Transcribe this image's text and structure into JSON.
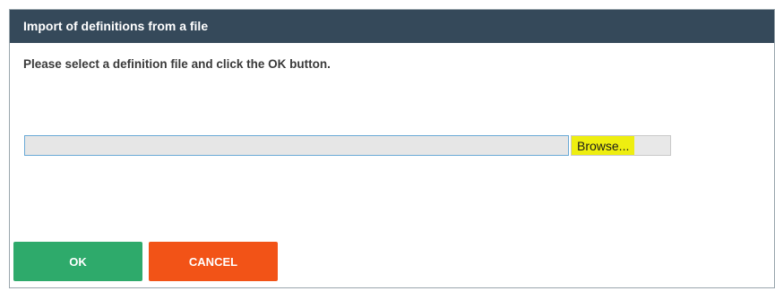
{
  "dialog": {
    "title": "Import of definitions from a file",
    "instructions": "Please select a definition file and click the OK button."
  },
  "file_input": {
    "value": "",
    "browse_label": "Browse..."
  },
  "buttons": {
    "ok_label": "OK",
    "cancel_label": "CANCEL"
  },
  "colors": {
    "titlebar": "#35495a",
    "ok": "#2eaa6b",
    "cancel": "#f25317",
    "browse_highlight": "#eeee10"
  }
}
